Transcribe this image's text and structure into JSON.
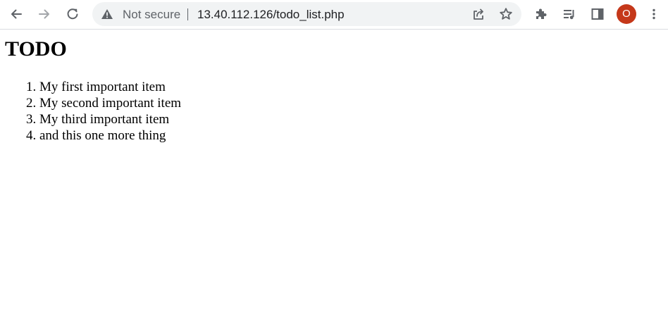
{
  "browser": {
    "security_label": "Not secure",
    "url": "13.40.112.126/todo_list.php",
    "profile_initial": "O",
    "accent_color": "#c5381a",
    "icons": [
      "back-icon",
      "forward-icon",
      "reload-icon",
      "warning-icon",
      "share-icon",
      "bookmark-star-icon",
      "extensions-icon",
      "reading-list-icon",
      "side-panel-icon",
      "more-menu-icon"
    ]
  },
  "page": {
    "title": "TODO",
    "items": [
      "My first important item",
      "My second important item",
      "My third important item",
      "and this one more thing"
    ]
  }
}
